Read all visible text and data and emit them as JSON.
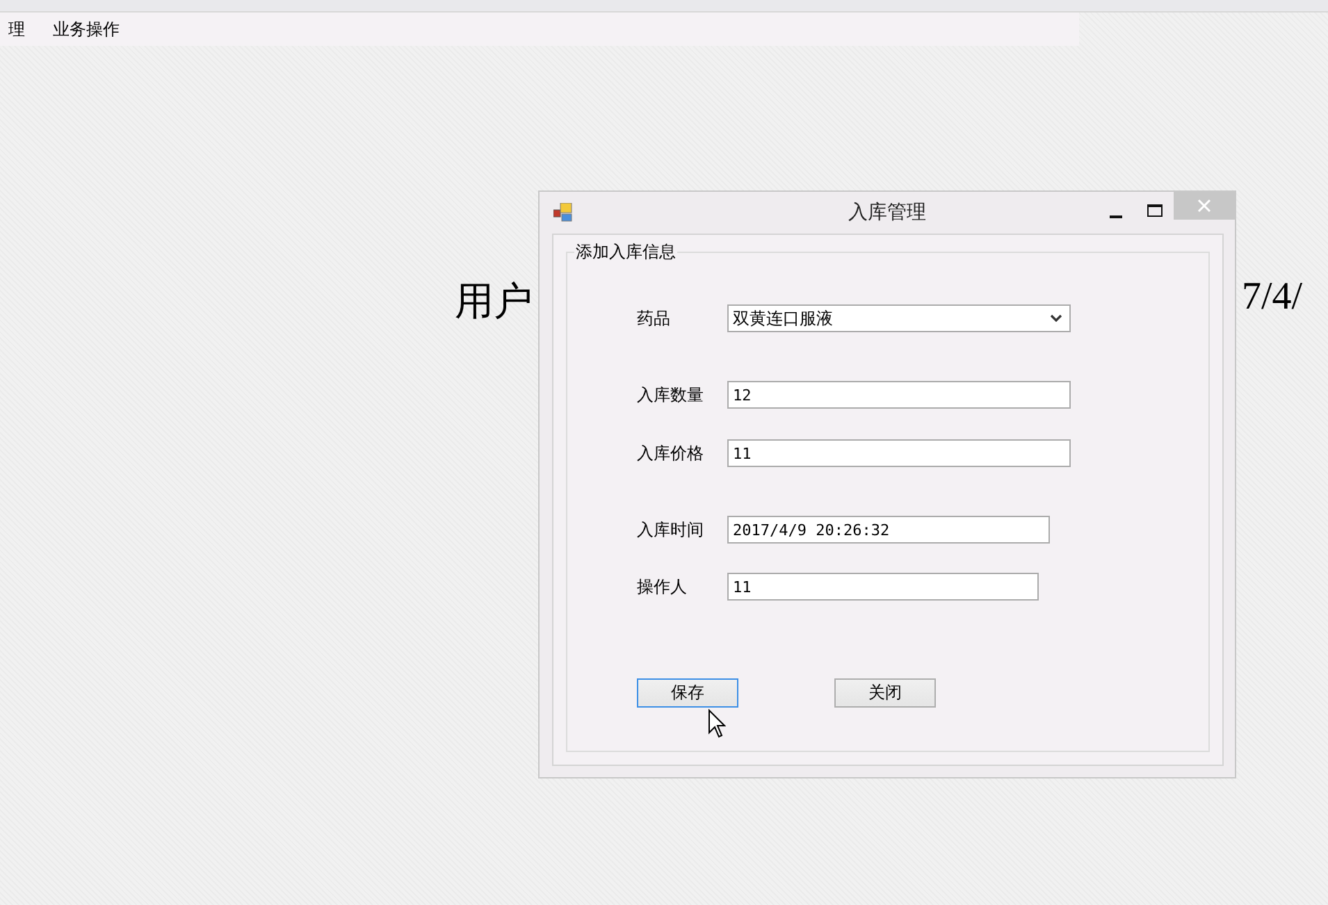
{
  "menu_bar": {
    "items": [
      {
        "label": "理"
      },
      {
        "label": "业务操作"
      }
    ]
  },
  "background": {
    "left_text": "用户",
    "right_text": "7/4/"
  },
  "dialog": {
    "title": "入库管理",
    "group_title": "添加入库信息",
    "fields": [
      {
        "kind": "select",
        "label": "药品",
        "value": "双黄连口服液"
      },
      {
        "kind": "text",
        "label": "入库数量",
        "value": "12"
      },
      {
        "kind": "text",
        "label": "入库价格",
        "value": "11"
      },
      {
        "kind": "text",
        "label": "入库时间",
        "value": "2017/4/9 20:26:32"
      },
      {
        "kind": "text",
        "label": "操作人",
        "value": "11"
      }
    ],
    "buttons": [
      {
        "label": "保存",
        "focused": true
      },
      {
        "label": "关闭",
        "focused": false
      }
    ]
  }
}
